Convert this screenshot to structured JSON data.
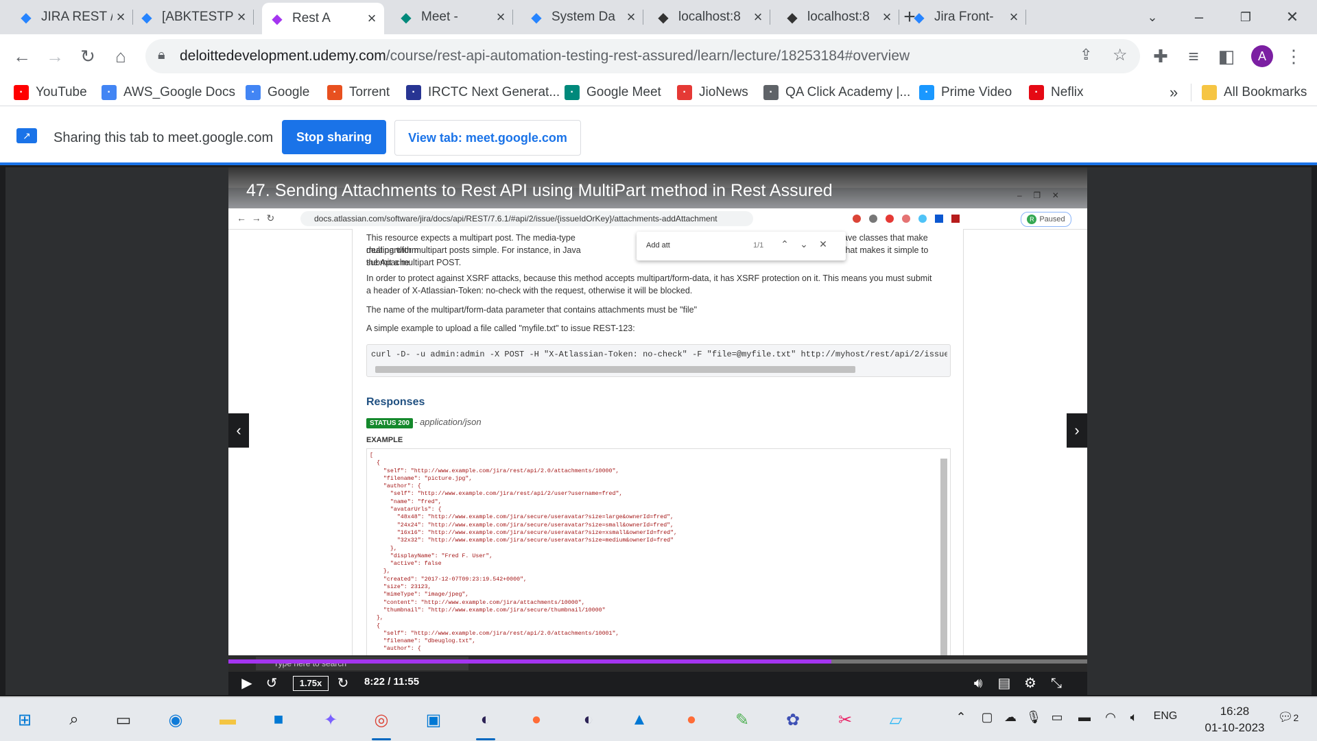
{
  "browser": {
    "tabs": [
      {
        "title": "JIRA REST /",
        "icon": "atlassian-icon",
        "color": "#2684ff"
      },
      {
        "title": "[ABKTESTP",
        "icon": "jira-icon",
        "color": "#2684ff"
      },
      {
        "title": "Rest A",
        "icon": "udemy-icon",
        "color": "#a435f0",
        "active": true
      },
      {
        "title": "Meet -",
        "icon": "meet-icon",
        "color": "#00897b"
      },
      {
        "title": "System Da",
        "icon": "jira-icon",
        "color": "#2684ff"
      },
      {
        "title": "localhost:8",
        "icon": "jenkins-icon",
        "color": "#333333"
      },
      {
        "title": "localhost:8",
        "icon": "jenkins-icon",
        "color": "#333333"
      },
      {
        "title": "Jira Front-",
        "icon": "atlassian-icon",
        "color": "#2684ff"
      }
    ],
    "url_domain": "deloittedevelopment.udemy.com",
    "url_path": "/course/rest-api-automation-testing-rest-assured/learn/lecture/18253184#overview",
    "profile_initial": "A",
    "bookmarks": [
      {
        "label": "YouTube",
        "icon": "youtube-icon",
        "color": "#ff0000"
      },
      {
        "label": "AWS_Google Docs",
        "icon": "docs-icon",
        "color": "#4285f4"
      },
      {
        "label": "Google",
        "icon": "google-icon",
        "color": "#4285f4"
      },
      {
        "label": "Torrent",
        "icon": "torrent-icon",
        "color": "#e8501f"
      },
      {
        "label": "IRCTC Next Generat...",
        "icon": "irctc-icon",
        "color": "#283593"
      },
      {
        "label": "Google Meet",
        "icon": "meet-icon",
        "color": "#00897b"
      },
      {
        "label": "JioNews",
        "icon": "jionews-icon",
        "color": "#e53935"
      },
      {
        "label": "QA Click Academy |...",
        "icon": "globe-icon",
        "color": "#5f6368"
      },
      {
        "label": "Prime Video",
        "icon": "prime-icon",
        "color": "#1a98ff"
      },
      {
        "label": "Neflix",
        "icon": "netflix-icon",
        "color": "#e50914"
      }
    ],
    "more_bookmarks": "»",
    "all_bookmarks": "All Bookmarks"
  },
  "sharing": {
    "text": "Sharing this tab to meet.google.com",
    "stop_label": "Stop sharing",
    "view_label": "View tab: meet.google.com"
  },
  "video": {
    "title": "47. Sending Attachments to Rest API using MultiPart method in Rest Assured",
    "speed": "1.75x",
    "time": "8:22 / 11:55",
    "progress": 0.702,
    "inner_url": "docs.atlassian.com/software/jira/docs/api/REST/7.6.1/#api/2/issue/{issueIdOrKey}/attachments-addAttachment",
    "inner_status": "Paused",
    "inner_profile": "R",
    "find_text": "Add att",
    "find_count": "1/1",
    "doc": {
      "p1a": "This resource expects a multipart post. The media-type multipart/form",
      "p1b": "dealing with multipart posts simple. For instance, in Java the Apache",
      "p1c": "submit a multipart POST.",
      "p1r1": "ave classes that make",
      "p1r2": "that makes it simple to",
      "p2": "In order to protect against XSRF attacks, because this method accepts multipart/form-data, it has XSRF protection on it. This means you must submit a header of X-Atlassian-Token: no-check with the request, otherwise it will be blocked.",
      "p3": "The name of the multipart/form-data parameter that contains attachments must be \"file\"",
      "p4": "A simple example to upload a file called \"myfile.txt\" to issue REST-123:",
      "curl": "curl -D- -u admin:admin -X POST -H \"X-Atlassian-Token: no-check\" -F \"file=@myfile.txt\" http://myhost/rest/api/2/issue/",
      "responses": "Responses",
      "status": "STATUS 200",
      "mime": "- application/json",
      "example": "EXAMPLE",
      "json": "[\n  {\n    \"self\": \"http://www.example.com/jira/rest/api/2.0/attachments/10000\",\n    \"filename\": \"picture.jpg\",\n    \"author\": {\n      \"self\": \"http://www.example.com/jira/rest/api/2/user?username=fred\",\n      \"name\": \"fred\",\n      \"avatarUrls\": {\n        \"48x48\": \"http://www.example.com/jira/secure/useravatar?size=large&ownerId=fred\",\n        \"24x24\": \"http://www.example.com/jira/secure/useravatar?size=small&ownerId=fred\",\n        \"16x16\": \"http://www.example.com/jira/secure/useravatar?size=xsmall&ownerId=fred\",\n        \"32x32\": \"http://www.example.com/jira/secure/useravatar?size=medium&ownerId=fred\"\n      },\n      \"displayName\": \"Fred F. User\",\n      \"active\": false\n    },\n    \"created\": \"2017-12-07T09:23:19.542+0000\",\n    \"size\": 23123,\n    \"mimeType\": \"image/jpeg\",\n    \"content\": \"http://www.example.com/jira/attachments/10000\",\n    \"thumbnail\": \"http://www.example.com/jira/secure/thumbnail/10000\"\n  },\n  {\n    \"self\": \"http://www.example.com/jira/rest/api/2.0/attachments/10001\",\n    \"filename\": \"dbeuglog.txt\",\n    \"author\": {"
    },
    "inner_search": "Type here to search"
  },
  "taskbar": {
    "apps": [
      {
        "name": "windows-start-icon",
        "glyph": "⊞",
        "color": "#0078d4"
      },
      {
        "name": "search-icon",
        "glyph": "⌕",
        "color": "#222222"
      },
      {
        "name": "task-view-icon",
        "glyph": "▭",
        "color": "#222222"
      },
      {
        "name": "edge-icon",
        "glyph": "◉",
        "color": "#0f7bd8"
      },
      {
        "name": "file-explorer-icon",
        "glyph": "▬",
        "color": "#f4c542"
      },
      {
        "name": "store-icon",
        "glyph": "■",
        "color": "#0078d4"
      },
      {
        "name": "copilot-icon",
        "glyph": "✦",
        "color": "#7b61ff"
      },
      {
        "name": "chrome-icon",
        "glyph": "◎",
        "color": "#db4437",
        "running": true
      },
      {
        "name": "remote-desktop-icon",
        "glyph": "▣",
        "color": "#0078d4"
      },
      {
        "name": "eclipse-icon",
        "glyph": "◐",
        "color": "#2c2255",
        "running": true
      },
      {
        "name": "postman-icon",
        "glyph": "●",
        "color": "#ff6c37"
      },
      {
        "name": "eclipse-2-icon",
        "glyph": "◐",
        "color": "#2c2255"
      },
      {
        "name": "photos-icon",
        "glyph": "▲",
        "color": "#0078d4"
      },
      {
        "name": "postman-2-icon",
        "glyph": "●",
        "color": "#ff6c37"
      },
      {
        "name": "notepad-icon",
        "glyph": "✎",
        "color": "#4caf50"
      },
      {
        "name": "paint-icon",
        "glyph": "✿",
        "color": "#3f51b5"
      },
      {
        "name": "snipping-tool-icon",
        "glyph": "✂",
        "color": "#e91e63"
      },
      {
        "name": "notepad-2-icon",
        "glyph": "▱",
        "color": "#29b6f6"
      }
    ],
    "language": "ENG",
    "time": "16:28",
    "date": "01-10-2023",
    "notifications": "2"
  }
}
